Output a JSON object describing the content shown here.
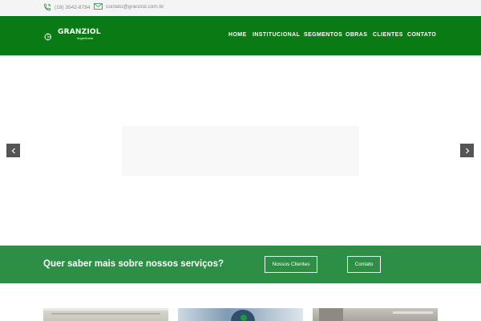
{
  "topbar": {
    "phone_icon": "phone-icon",
    "phone": "(19) 3542-8784",
    "email_icon": "envelope-icon",
    "email": "contato@granziol.com.br"
  },
  "header": {
    "logo_text": "GRANZIOL",
    "logo_sub": "engenharia",
    "nav": [
      "HOME",
      "INSTITUCIONAL",
      "SEGMENTOS",
      "OBRAS",
      "CLIENTES",
      "CONTATO"
    ]
  },
  "slider": {
    "prev_icon": "chevron-left-icon",
    "next_icon": "chevron-right-icon"
  },
  "cta": {
    "title": "Quer saber mais sobre nossos serviços?",
    "btn_clients": "Nossos Clientes",
    "btn_contact": "Contato"
  },
  "colors": {
    "nav_green": "#0a7a14",
    "cta_green": "#2d8f45",
    "topbar": "#f4f4f4"
  }
}
